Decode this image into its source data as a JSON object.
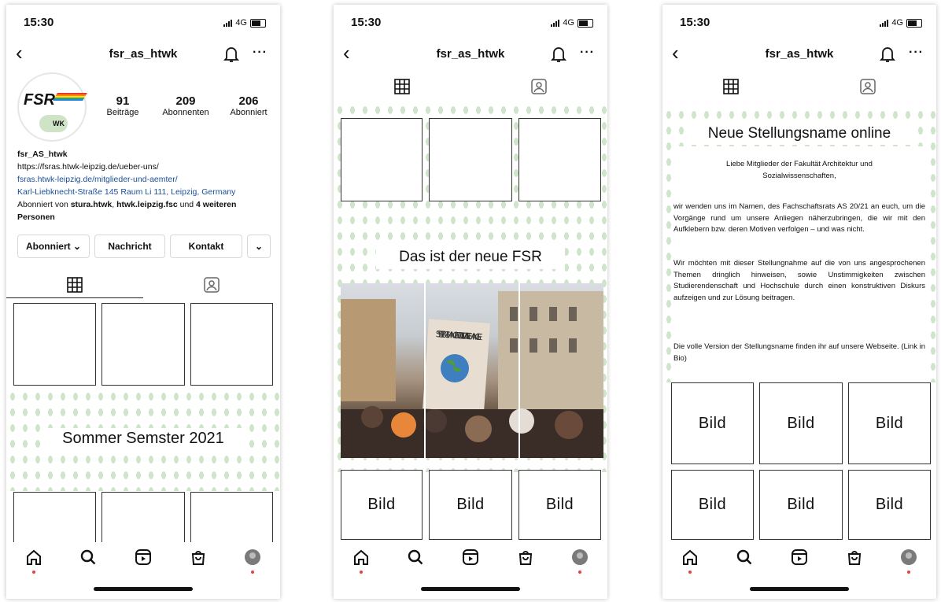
{
  "status": {
    "time": "15:30",
    "network": "4G"
  },
  "nav": {
    "username": "fsr_as_htwk",
    "back": "‹",
    "more": "···"
  },
  "profile": {
    "logo_text": "FSR",
    "badge_text": "WK",
    "stats": [
      {
        "num": "91",
        "label": "Beiträge"
      },
      {
        "num": "209",
        "label": "Abonnenten"
      },
      {
        "num": "206",
        "label": "Abonniert"
      }
    ],
    "name": "fsr_AS_htwk",
    "url1": "https://fsras.htwk-leipzig.de/ueber-uns/",
    "url2": "fsras.htwk-leipzig.de/mitglieder-und-aemter/",
    "address": "Karl-Liebknecht-Straße 145 Raum Li 111, Leipzig, Germany",
    "followed_prefix": "Abonniert von ",
    "followed_a": "stura.htwk",
    "followed_sep": ", ",
    "followed_b": "htwk.leipzig.fsc",
    "followed_and": " und ",
    "followed_more": "4 weiteren Personen",
    "buttons": {
      "abonniert": "Abonniert ⌄",
      "nachricht": "Nachricht",
      "kontakt": "Kontakt",
      "dropdown": "⌄"
    }
  },
  "screen1": {
    "banner": "Sommer Semster 2021"
  },
  "screen2": {
    "banner": "Das ist der neue FSR",
    "sign_text": "SYSTEM CHANGE NOT CLIMATE CHANGE",
    "cell_label": "Bild"
  },
  "screen3": {
    "title": "Neue Stellungsname online",
    "greeting": "Liebe Mitglieder der Fakultät Architektur und Sozialwissenschaften,",
    "p1": "wir wenden uns im Namen, des Fachschaftsrats AS 20/21 an euch, um die Vorgänge rund um unsere Anliegen näherzubringen, die wir mit den Aufklebern bzw. deren Motiven verfolgen – und was nicht.",
    "p2": "Wir möchten mit dieser Stellungnahme auf die von uns angesprochenen Themen dringlich hinweisen, sowie Unstimmigkeiten zwischen Studierendenschaft und Hochschule durch einen konstruktiven Diskurs aufzeigen und zur Lösung beitragen.",
    "p3": "Die volle Version der Stellungsname finden ihr auf unsere Webseite. (Link in Bio)",
    "cell_label": "Bild"
  },
  "colors": {
    "dots": "#cfe5c9",
    "link": "#1a4f9a",
    "notify": "#e8403a"
  }
}
